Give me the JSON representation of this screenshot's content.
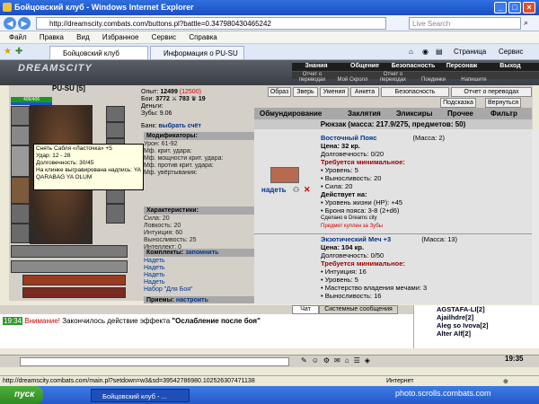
{
  "window": {
    "title": "Бойцовский клуб - Windows Internet Explorer"
  },
  "address": {
    "url": "http://dreamscity.combats.com/buttons.pl?battle=0.347980430465242",
    "search_placeholder": "Live Search"
  },
  "menu": [
    "Файл",
    "Правка",
    "Вид",
    "Избранное",
    "Сервис",
    "Справка"
  ],
  "toolbar": {
    "page_label": "Страница",
    "tools_label": "Сервис"
  },
  "tabs": [
    {
      "label": "Бойцовский клуб"
    },
    {
      "label": "Информация о PU-SU"
    }
  ],
  "game": {
    "logo": "DREAMSCITY",
    "top_nav": [
      "Знания",
      "Общение",
      "Безопасность",
      "Персонаж",
      "Выход"
    ],
    "sub_nav": [
      "Отчет о переводах",
      "Мой Скролл",
      "Отчет о переходах",
      "Поединки",
      "Напишите"
    ]
  },
  "character": {
    "name": "PU-SU",
    "level": "[5]",
    "hp": "406/406",
    "experience_label": "Опыт:",
    "experience": "12499",
    "experience_next": "(12500)",
    "battles_label": "Бои:",
    "battles": "3772",
    "wins": "783",
    "losses": "19",
    "money_label": "Деньги:",
    "teeth_label": "Зубы:",
    "teeth": "9.06",
    "bank_label": "Банк:",
    "bank_action": "выбрать счёт"
  },
  "modifiers": {
    "title": "Модификаторы:",
    "items": [
      "Урон: 61-92",
      "Мф. крит. удара:",
      "Мф. мощности крит. удара:",
      "Мф. против крит. удара:",
      "Мф. увёртывания:"
    ]
  },
  "tooltip": {
    "lines": [
      "Снять Сабля «Ласточка» +5",
      "Удар: 12 - 28",
      "Долговечность: 30/45",
      "На клинке выгравирована надпись: YA QARABAG YA OLUM"
    ]
  },
  "characteristics": {
    "title": "Характеристики:",
    "items": [
      "Сила: 20",
      "Ловкость: 20",
      "Интуиция: 60",
      "Выносливость: 25",
      "Интеллект: 0"
    ]
  },
  "sets": {
    "title": "Комплекты:",
    "remember": "запомнить",
    "items": [
      "Надеть",
      "Надеть",
      "Надеть",
      "Надеть",
      "Набор \"Для Боя\""
    ]
  },
  "techniques": {
    "title": "Приемы:",
    "setup": "настроить"
  },
  "actions": {
    "buttons": [
      "Образ",
      "Зверь",
      "Умения",
      "Анкета",
      "Безопасность",
      "Отчет о переводах"
    ],
    "gift": "Подсказка",
    "back": "Вернуться"
  },
  "inventory": {
    "tabs": [
      "Обмундирование",
      "Заклятия",
      "Эликсиры",
      "Прочее",
      "Фильтр"
    ],
    "title": "Рюкзак (масса: 217.9/275, предметов: 50)",
    "items": [
      {
        "name": "Восточный Пояс",
        "mass": "(Масса: 2)",
        "price": "Цена: 32 кр.",
        "durability": "Долговечность: 0/20",
        "req_title": "Требуется минимальное:",
        "requirements": [
          "• Уровень: 5",
          "• Выносливость: 20",
          "• Сила: 20"
        ],
        "act_title": "Действует на:",
        "effects": [
          "• Уровень жизни (HP): +45",
          "• Броня пояса: 3-8 (2+d6)"
        ],
        "made_in": "Сделано в Dreams city",
        "purchased": "Предмет куплен за Зубы",
        "wear": "надеть"
      },
      {
        "name": "Экзотический Меч +3",
        "mass": "(Масса: 13)",
        "price": "Цена: 104 кр.",
        "durability": "Долговечность: 0/50",
        "req_title": "Требуется минимальное:",
        "requirements": [
          "• Интуиция: 16",
          "• Уровень: 5",
          "• Мастерство владения мечами: 3",
          "• Выносливость: 16"
        ]
      }
    ]
  },
  "chat": {
    "tabs": [
      "Чат",
      "Системные сообщения"
    ],
    "time": "19:34",
    "attention": "Внимание!",
    "message": "Закончилось действие эффекта",
    "effect": "\"Ослабление после боя\""
  },
  "online": [
    "AGSTAFA-LI[2]",
    "Ajailhdre[2]",
    "Aleg so Ivova[2]",
    "Alter Alf[2]"
  ],
  "clock": "19:35",
  "status": {
    "url": "http://dreamscity.combats.com/main.pl?setdown=w3&sd=39542786980.102526307471138",
    "zone": "Интернет"
  },
  "taskbar": {
    "start": "пуск",
    "item": "Бойцовский клуб - ...",
    "watermark": "photo.scrolls.combats.com"
  },
  "colors": {
    "accent_blue": "#00338c",
    "required_red": "#990000",
    "green": "#006000"
  }
}
